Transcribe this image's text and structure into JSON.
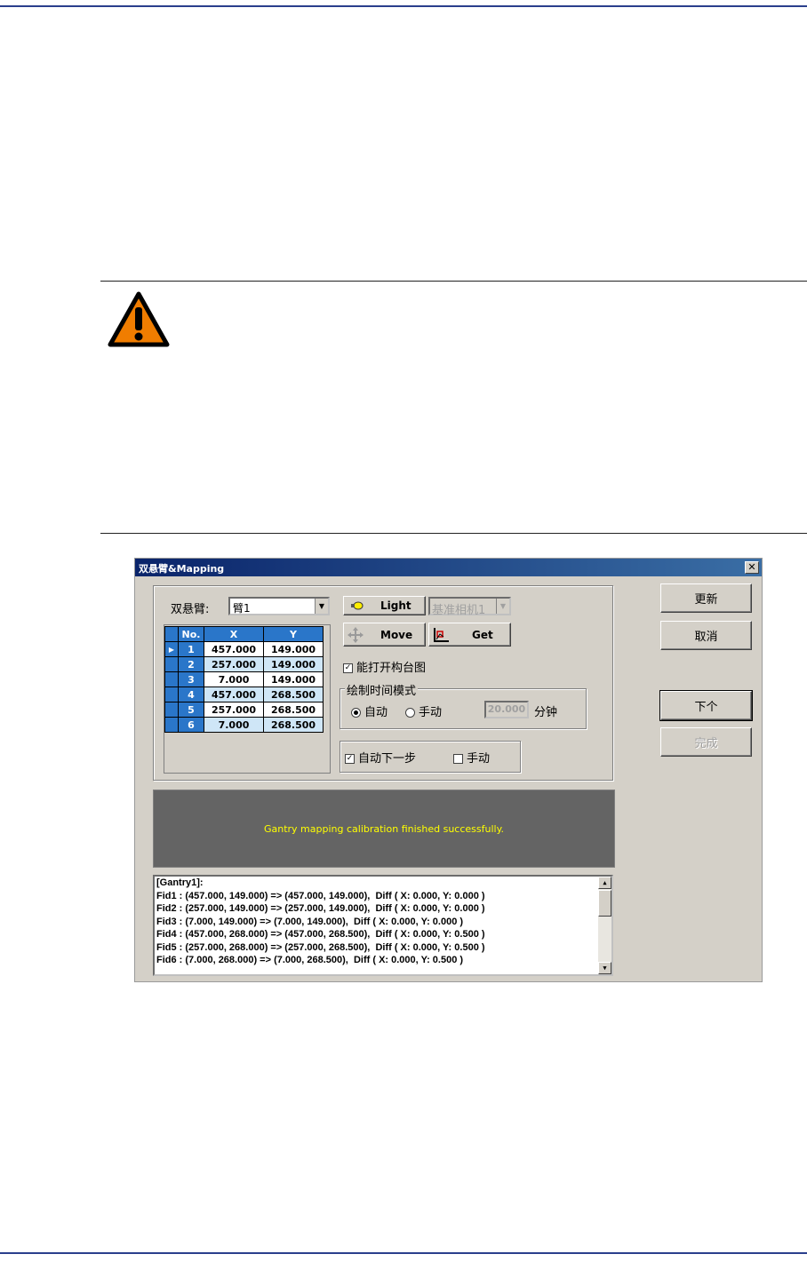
{
  "dialog": {
    "title": "双悬臂&Mapping",
    "close": "✕",
    "arm_label": "双悬臂:",
    "arm_value": "臂1",
    "light_label": "Light",
    "camera_value": "基准相机1",
    "move_label": "Move",
    "get_label": "Get",
    "open_table_label": "能打开构台图",
    "draw_group_label": "绘制时间模式",
    "auto_label": "自动",
    "manual_label": "手动",
    "time_value": "20.000",
    "time_unit": "分钟",
    "auto_next_label": "自动下一步",
    "manual2_label": "手动",
    "update_btn": "更新",
    "cancel_btn": "取消",
    "next_btn": "下个",
    "finish_btn": "完成",
    "status_message": "Gantry mapping calibration finished successfully.",
    "grid_headers": [
      "No.",
      "X",
      "Y"
    ],
    "grid_rows": [
      {
        "no": "1",
        "x": "457.000",
        "y": "149.000"
      },
      {
        "no": "2",
        "x": "257.000",
        "y": "149.000"
      },
      {
        "no": "3",
        "x": "7.000",
        "y": "149.000"
      },
      {
        "no": "4",
        "x": "457.000",
        "y": "268.500"
      },
      {
        "no": "5",
        "x": "257.000",
        "y": "268.500"
      },
      {
        "no": "6",
        "x": "7.000",
        "y": "268.500"
      }
    ],
    "log_lines": [
      "[Gantry1]:",
      "Fid1 : (457.000, 149.000) => (457.000, 149.000),  Diff ( X: 0.000, Y: 0.000 )",
      "Fid2 : (257.000, 149.000) => (257.000, 149.000),  Diff ( X: 0.000, Y: 0.000 )",
      "Fid3 : (7.000, 149.000) => (7.000, 149.000),  Diff ( X: 0.000, Y: 0.000 )",
      "Fid4 : (457.000, 268.000) => (457.000, 268.500),  Diff ( X: 0.000, Y: 0.500 )",
      "Fid5 : (257.000, 268.000) => (257.000, 268.500),  Diff ( X: 0.000, Y: 0.500 )",
      "Fid6 : (7.000, 268.000) => (7.000, 268.500),  Diff ( X: 0.000, Y: 0.500 )"
    ]
  },
  "colors": {
    "rule": "#2a3f8c",
    "warning_fill": "#f07d00",
    "status_text": "#ffff00"
  },
  "icons": [
    "warning-icon",
    "light-bulb-icon",
    "move-arrows-icon",
    "get-axis-icon",
    "close-icon"
  ]
}
